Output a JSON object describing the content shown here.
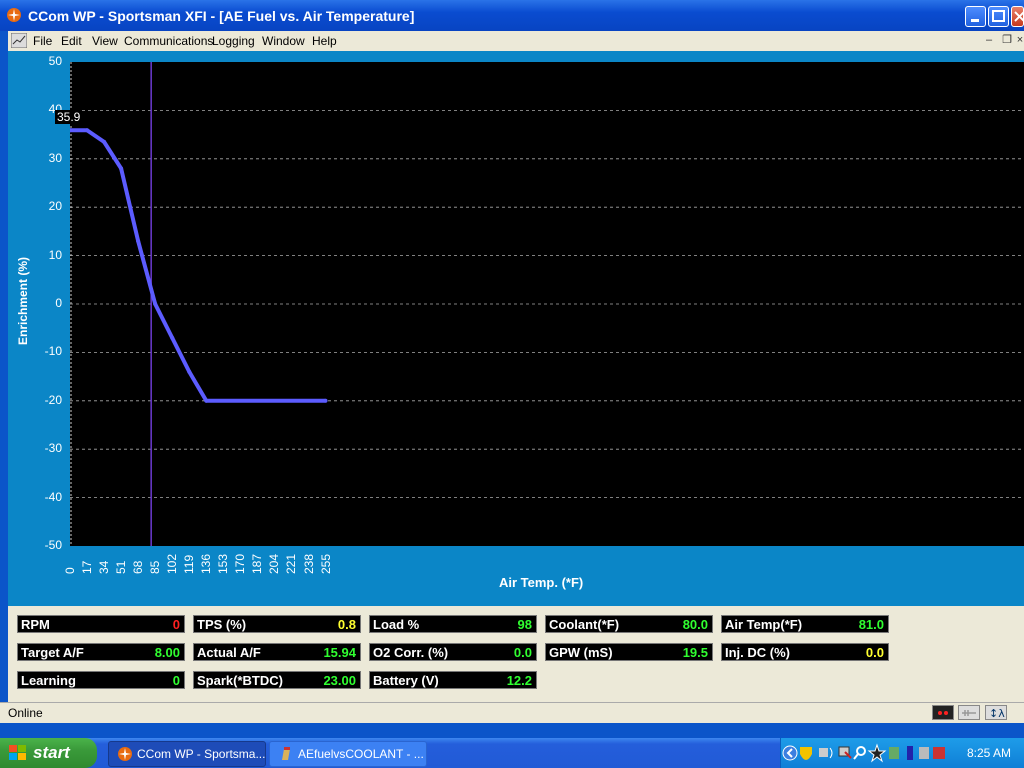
{
  "window": {
    "title": "CCom WP - Sportsman XFI  - [AE Fuel vs. Air Temperature]"
  },
  "menu": [
    "File",
    "Edit",
    "View",
    "Communications",
    "Logging",
    "Window",
    "Help"
  ],
  "chart_data": {
    "type": "line",
    "xlabel": "Air Temp. (*F)",
    "ylabel": "Enrichment (%)",
    "xlim": [
      0,
      255
    ],
    "ylim": [
      -50,
      50
    ],
    "x_ticks": [
      "0",
      "17",
      "34",
      "51",
      "68",
      "85",
      "102",
      "119",
      "136",
      "153",
      "170",
      "187",
      "204",
      "221",
      "238",
      "255"
    ],
    "y_ticks": [
      "50",
      "40",
      "30",
      "20",
      "10",
      "0",
      "-10",
      "-20",
      "-30",
      "-40",
      "-50"
    ],
    "grid": true,
    "series": [
      {
        "color": "#5c5cff",
        "x": [
          0,
          17,
          34,
          51,
          68,
          85,
          102,
          119,
          136,
          255
        ],
        "y": [
          35.9,
          35.9,
          33.5,
          28,
          13,
          0,
          -7,
          -14,
          -20,
          -20
        ]
      }
    ],
    "cursor_x": 81,
    "cursor_readout": "35.9"
  },
  "gauges": [
    {
      "label": "RPM",
      "value": "0",
      "color": "#ff2020"
    },
    {
      "label": "TPS (%)",
      "value": "0.8",
      "color": "#ffff30"
    },
    {
      "label": "Load %",
      "value": "98",
      "color": "#30ff30"
    },
    {
      "label": "Coolant(*F)",
      "value": "80.0",
      "color": "#30ff30"
    },
    {
      "label": "Air Temp(*F)",
      "value": "81.0",
      "color": "#30ff30"
    },
    {
      "label": "Target A/F",
      "value": "8.00",
      "color": "#30ff30"
    },
    {
      "label": "Actual A/F",
      "value": "15.94",
      "color": "#30ff30"
    },
    {
      "label": "O2 Corr. (%)",
      "value": "0.0",
      "color": "#30ff30"
    },
    {
      "label": "GPW (mS)",
      "value": "19.5",
      "color": "#30ff30"
    },
    {
      "label": "Inj. DC (%)",
      "value": "0.0",
      "color": "#ffff30"
    },
    {
      "label": "Learning",
      "value": "0",
      "color": "#30ff30"
    },
    {
      "label": "Spark(*BTDC)",
      "value": "23.00",
      "color": "#30ff30"
    },
    {
      "label": "Battery (V)",
      "value": "12.2",
      "color": "#30ff30"
    }
  ],
  "status": {
    "text": "Online"
  },
  "taskbar": {
    "start_label": "start",
    "tasks": [
      "CCom WP - Sportsma...",
      "AEfuelvsCOOLANT - ..."
    ],
    "clock": "8:25 AM"
  }
}
